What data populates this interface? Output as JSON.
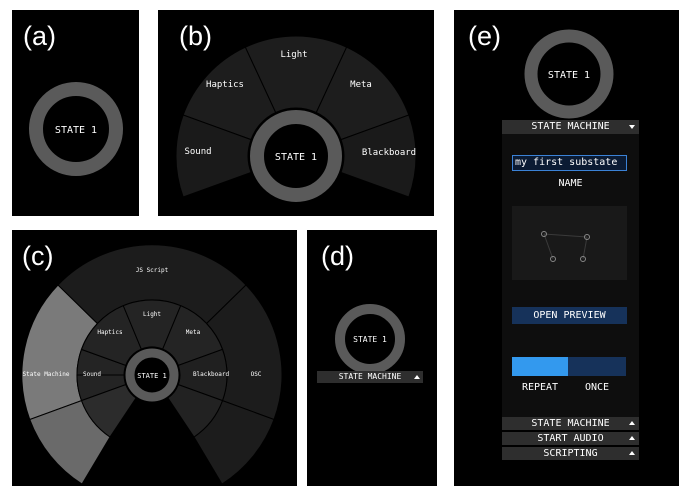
{
  "panels": {
    "a": {
      "label": "(a)",
      "state": "STATE 1"
    },
    "b": {
      "label": "(b)",
      "state": "STATE 1",
      "menu": {
        "light": "Light",
        "haptics": "Haptics",
        "meta": "Meta",
        "sound": "Sound",
        "blackboard": "Blackboard"
      }
    },
    "c": {
      "label": "(c)",
      "state": "STATE 1",
      "menu": {
        "js_script": "JS Script",
        "light": "Light",
        "haptics": "Haptics",
        "meta": "Meta",
        "sound": "Sound",
        "blackboard": "Blackboard",
        "state_machine": "State Machine",
        "osc": "OSC"
      }
    },
    "d": {
      "label": "(d)",
      "state": "STATE 1",
      "dropdown": "STATE MACHINE"
    },
    "e": {
      "label": "(e)",
      "state": "STATE 1",
      "dropdown": "STATE MACHINE",
      "name_value": "my first substate",
      "name_label": "NAME",
      "preview_button": "OPEN PREVIEW",
      "repeat_label": "REPEAT",
      "once_label": "ONCE",
      "sections": [
        "STATE MACHINE",
        "START AUDIO",
        "SCRIPTING"
      ]
    }
  },
  "colors": {
    "panel_bg": "#000000",
    "ring": "#5a5a5a",
    "accent_blue": "#3399ee",
    "dark_blue": "#16325a"
  }
}
